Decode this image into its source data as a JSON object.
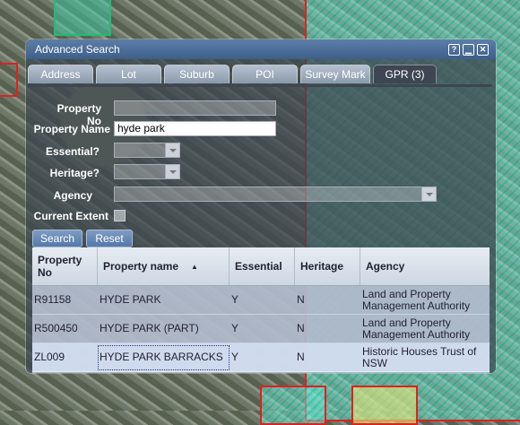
{
  "window": {
    "title": "Advanced Search",
    "buttons": [
      "?",
      "_",
      "x"
    ]
  },
  "tabs": [
    {
      "label": "Address",
      "active": false
    },
    {
      "label": "Lot",
      "active": false
    },
    {
      "label": "Suburb",
      "active": false
    },
    {
      "label": "POI",
      "active": false
    },
    {
      "label": "Survey Mark",
      "active": false
    },
    {
      "label": "GPR (3)",
      "active": true
    }
  ],
  "form": {
    "property_no": {
      "label": "Property No",
      "value": ""
    },
    "property_name": {
      "label": "Property Name",
      "value": "hyde park"
    },
    "essential": {
      "label": "Essential?",
      "value": ""
    },
    "heritage": {
      "label": "Heritage?",
      "value": ""
    },
    "agency": {
      "label": "Agency",
      "value": ""
    },
    "current_extent": {
      "label": "Current Extent",
      "checked": false
    }
  },
  "buttons": {
    "search": "Search",
    "reset": "Reset"
  },
  "grid": {
    "columns": [
      "Property No",
      "Property name",
      "Essential",
      "Heritage",
      "Agency"
    ],
    "sort_column": "Property name",
    "sort_direction": "ascending",
    "rows": [
      [
        "R91158",
        "HYDE PARK",
        "Y",
        "N",
        "Land and Property Management Authority"
      ],
      [
        "R500450",
        "HYDE PARK (PART)",
        "Y",
        "N",
        "Land and Property Management Authority"
      ],
      [
        "ZL009",
        "HYDE PARK BARRACKS",
        "Y",
        "N",
        "Historic Houses Trust of NSW"
      ]
    ],
    "selected_row": 2
  },
  "colors": {
    "titlebar": "#4a6c98",
    "zone_fill": "#3cd2b4",
    "zone_border": "#e02020"
  }
}
